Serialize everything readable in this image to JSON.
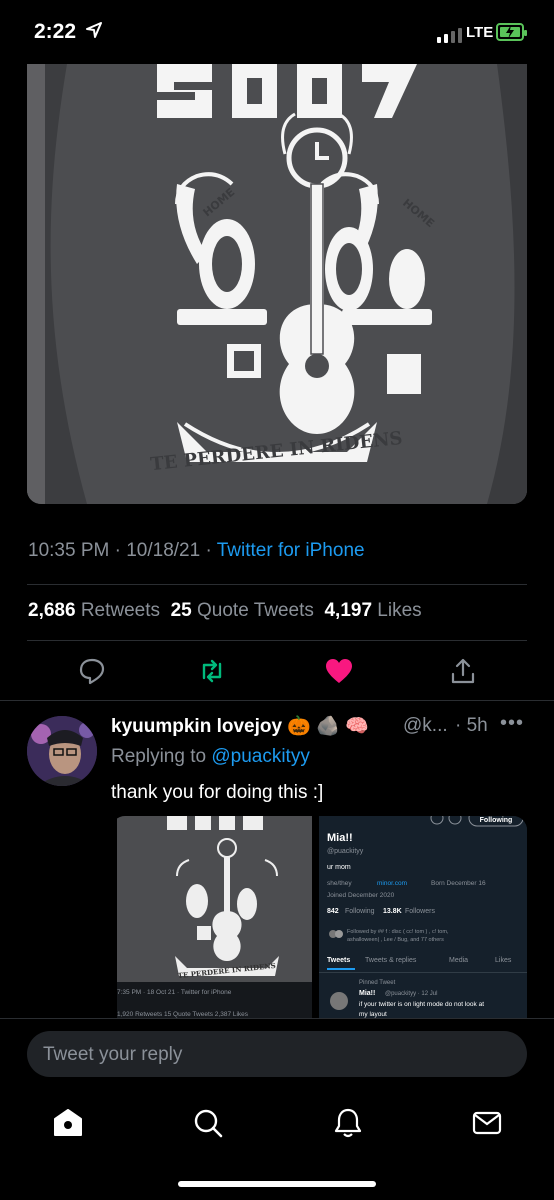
{
  "status_bar": {
    "time": "2:22",
    "network": "LTE",
    "battery_color": "#5ac35a"
  },
  "tweet": {
    "image": {
      "motto": "TE PERDERE IN RIDENS",
      "banner_left": "HOME",
      "banner_right": "HOME",
      "top_text": "SOOT"
    },
    "time": "10:35 PM",
    "date": "10/18/21",
    "source": "Twitter for iPhone",
    "retweets_count": "2,686",
    "retweets_label": "Retweets",
    "quotes_count": "25",
    "quotes_label": "Quote Tweets",
    "likes_count": "4,197",
    "likes_label": "Likes",
    "liked_color": "#f91880",
    "retweet_color": "#00ba7c"
  },
  "reply": {
    "name": "kyuumpkin lovejoy",
    "emoji": [
      "🎃",
      "🪨",
      "🧠"
    ],
    "handle": "@k...",
    "age": "5h",
    "replying_prefix": "Replying to",
    "replying_handle": "@puackityy",
    "text": "thank you for doing this :]",
    "screenshot_left": {
      "motto": "TE PERDERE IN RIDENS",
      "meta": "7:35 PM · 18 Oct 21 · Twitter for iPhone",
      "stats": "1,920 Retweets  15 Quote Tweets  2,387 Likes"
    },
    "screenshot_right": {
      "following": "Following",
      "name": "Mia!!",
      "handle": "@puackityy",
      "bio": "ur mom",
      "pronouns": "she/they",
      "link": "minor.com",
      "born": "Born December 16",
      "joined": "Joined December 2020",
      "following_count": "842",
      "following_label": "Following",
      "followers_count": "13.8K",
      "followers_label": "Followers",
      "followed_by": "Followed by ## f : disc ( cc! tom ) , c! tom, ashalloween| , Lee / Bug, and 77 others",
      "tabs": [
        "Tweets",
        "Tweets & replies",
        "Media",
        "Likes"
      ],
      "pinned_label": "Pinned Tweet",
      "pinned_name": "Mia!!",
      "pinned_handle": "@puackityy · 12 Jul",
      "pinned_text": "if your twitter is on light mode do not look at my layout"
    }
  },
  "compose_placeholder": "Tweet your reply"
}
